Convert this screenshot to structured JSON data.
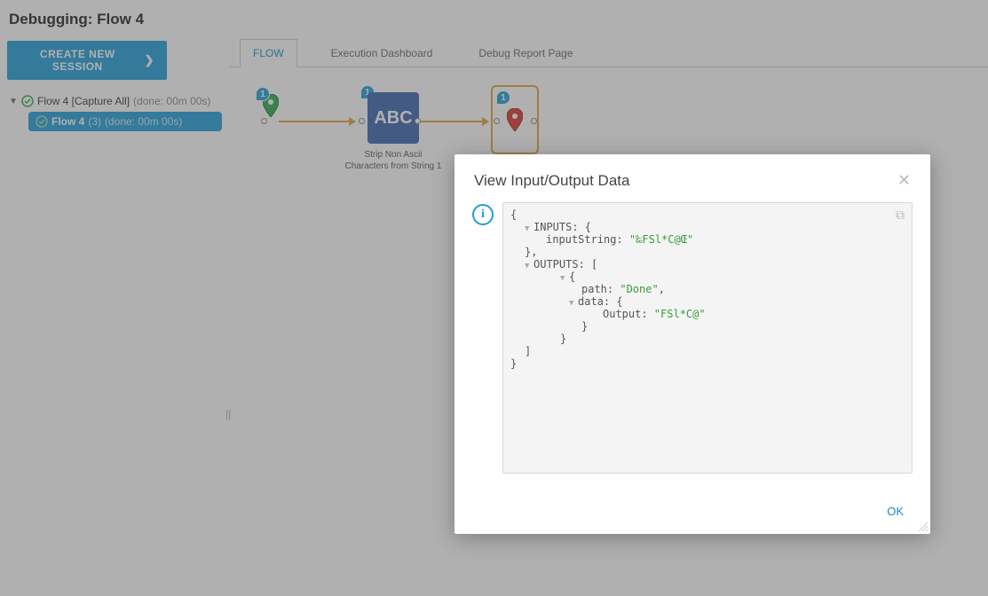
{
  "header": {
    "title": "Debugging: Flow 4"
  },
  "sidebar": {
    "create_label": "CREATE NEW SESSION",
    "root": {
      "label": "Flow 4 [Capture All]",
      "status": "(done: 00m 00s)"
    },
    "child": {
      "label": "Flow 4",
      "count": "(3)",
      "status": "(done: 00m 00s)"
    }
  },
  "tabs": {
    "flow": "FLOW",
    "exec": "Execution Dashboard",
    "report": "Debug Report Page"
  },
  "flowchart": {
    "badge": "1",
    "abc_text": "ABC",
    "abc_caption_line1": "Strip Non Ascii",
    "abc_caption_line2": "Characters from String 1"
  },
  "modal": {
    "title": "View Input/Output Data",
    "ok": "OK",
    "json": {
      "open": "{",
      "inputs_label": "INPUTS: {",
      "inputString_key": "inputString: ",
      "inputString_val": "\"‰FSl*C@Œ\"",
      "close_inputs": "},",
      "outputs_label": "OUTPUTS: [",
      "arr_open": "{",
      "path_key": "path: ",
      "path_val": "\"Done\"",
      "data_key": "data: {",
      "output_key": "Output: ",
      "output_val": "\"FSl*C@\"",
      "close_data": "}",
      "close_arr_obj": "}",
      "close_outputs": "]",
      "close_root": "}"
    }
  }
}
